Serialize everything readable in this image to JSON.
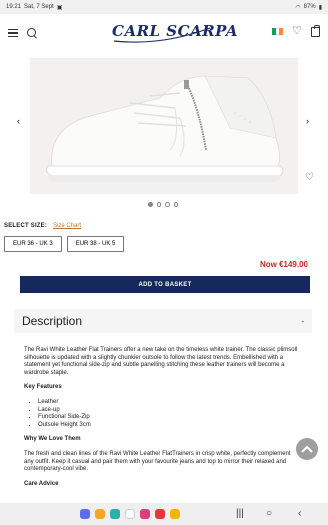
{
  "status_bar": {
    "time": "19:21",
    "date": "Sat, 7 Sept",
    "battery": "87%"
  },
  "header": {
    "logo_text": "CARL SCARPA"
  },
  "gallery": {
    "prev": "‹",
    "next": "›",
    "dot_count": 4,
    "active_dot": 0
  },
  "size": {
    "label": "SELECT SIZE:",
    "chart_link": "Size Chart",
    "options": [
      "EUR 36 - UK 3",
      "EUR 38 - UK 5"
    ]
  },
  "price": {
    "text": "Now €149.00"
  },
  "cta": {
    "add_to_basket": "ADD TO BASKET"
  },
  "description": {
    "title": "Description",
    "toggle": "-",
    "intro": "The Ravi White Leather Flat Trainers offer a new take on the timeless white trainer. The classic plimsoll silhouette is updated with a slightly chunkier outsole to follow the latest trends. Embellished with a statement yet functional side-zip and subtle panelling stitching these leather trainers will become a wardrobe staple.",
    "features_heading": "Key Features",
    "features": [
      "Leather",
      "Lace-up",
      "Functional Side-Zip",
      "Outsole Height 3cm"
    ],
    "love_heading": "Why We Love Them",
    "love_text": "The fresh and clean lines of the Ravi White Leather FlatTrainers in crisp white, perfectly complement any outfit. Keep it casual and pair them with your favourite jeans and top to mirror their relaxed and contemporary-cool vibe.",
    "care_heading": "Care Advice"
  },
  "colors": {
    "brand_navy": "#16295b",
    "price_red": "#c62828",
    "link_gold": "#b07a36"
  }
}
